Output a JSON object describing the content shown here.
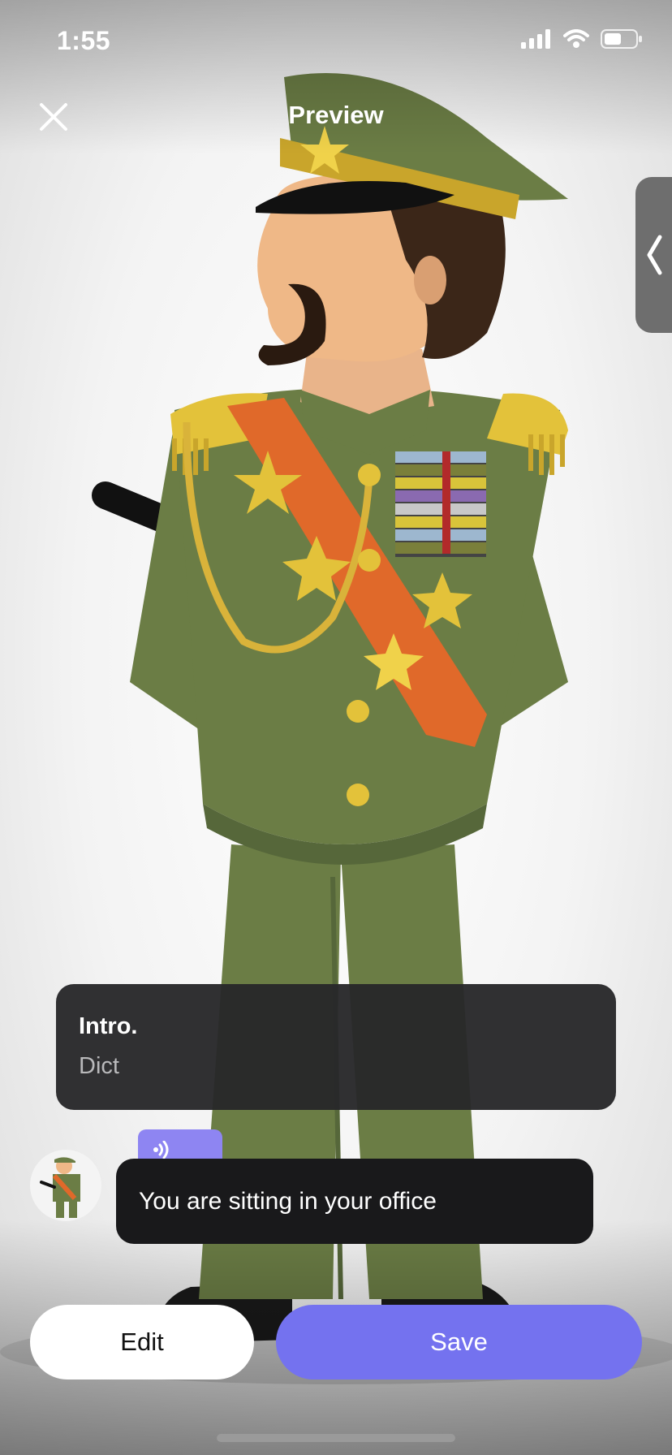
{
  "status_bar": {
    "time": "1:55"
  },
  "header": {
    "title": "Preview",
    "close_icon": "close-icon",
    "side_tab_icon": "chevron-left-icon"
  },
  "intro": {
    "title": "Intro.",
    "subtitle": "Dict"
  },
  "chat": {
    "message": "You are sitting in your office",
    "badge_icon": "speaker-icon"
  },
  "actions": {
    "edit_label": "Edit",
    "save_label": "Save"
  },
  "colors": {
    "accent": "#7472ef",
    "badge": "#8e85f2",
    "uniform": "#6b7d45",
    "sash": "#e0692a",
    "gold": "#e3c23a"
  }
}
